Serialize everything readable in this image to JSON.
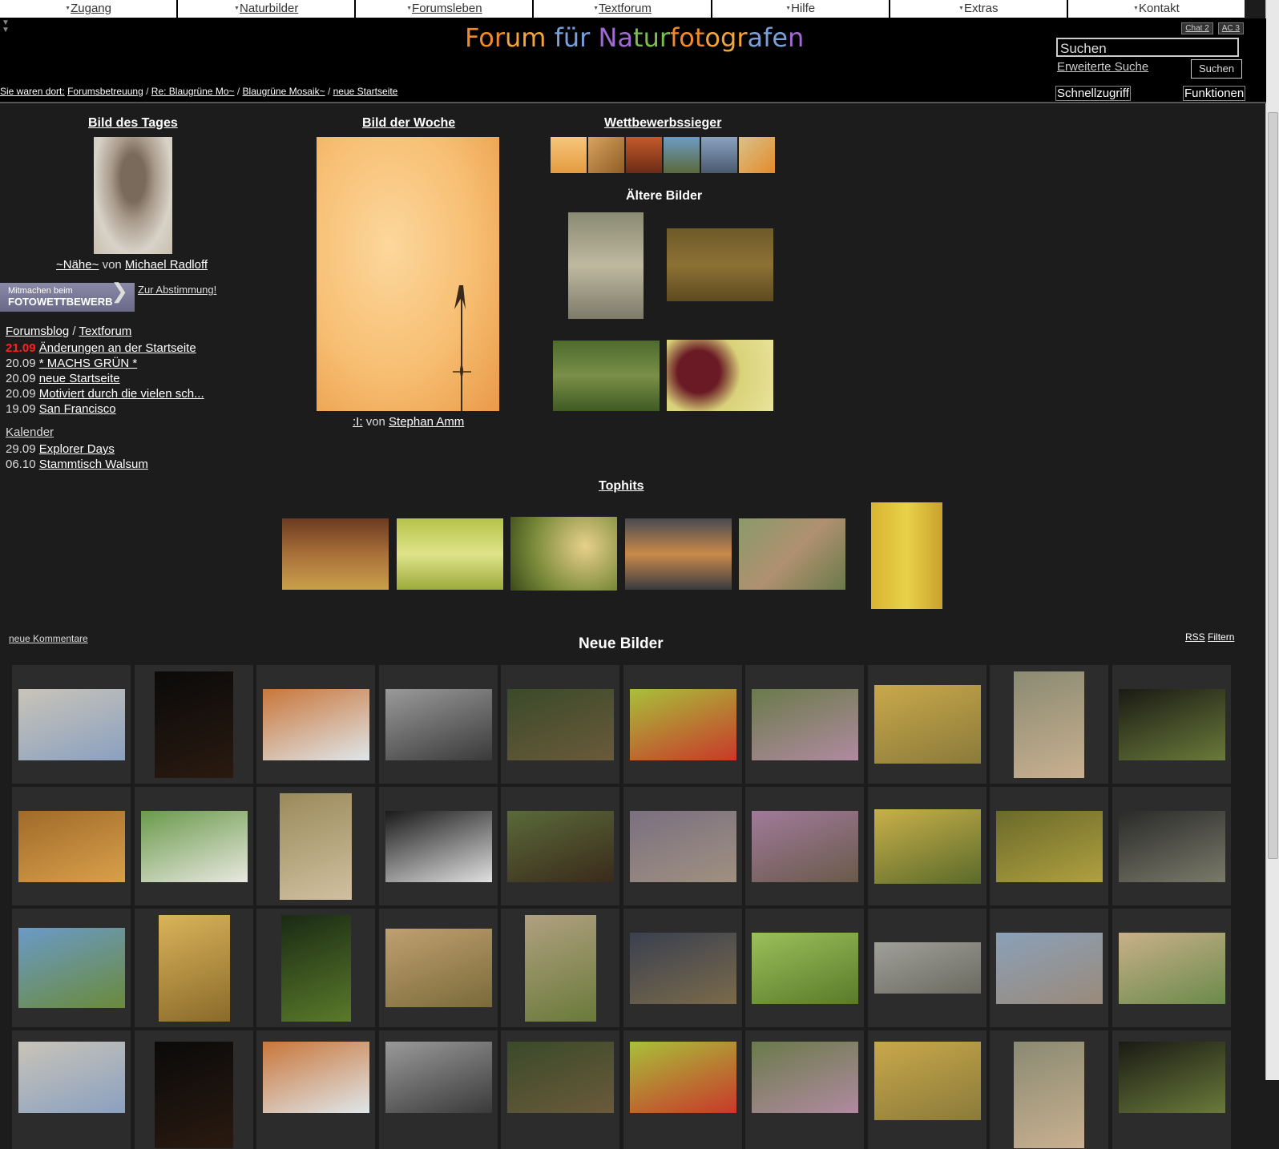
{
  "menu": [
    {
      "label": "Zugang"
    },
    {
      "label": "Naturbilder"
    },
    {
      "label": "Forumsleben"
    },
    {
      "label": "Textforum"
    },
    {
      "label": "Hilfe"
    },
    {
      "label": "Extras"
    },
    {
      "label": "Kontakt"
    }
  ],
  "logo": "Forum für Naturfotografen",
  "chat": {
    "chat2": "Chat 2",
    "ac3": "AC 3"
  },
  "search": {
    "value": "Suchen",
    "advanced": "Erweiterte Suche",
    "button": "Suchen"
  },
  "breadcrumb": {
    "prefix": "Sie waren dort:",
    "items": [
      "Forumsbetreuung",
      "Re: Blaugrüne Mo~",
      "Blaugrüne Mosaik~",
      "neue Startseite"
    ]
  },
  "quick": "Schnellzugriff",
  "functions": "Funktionen",
  "bild_des_tages": {
    "heading": "Bild des Tages",
    "title": "~Nähe~",
    "von": "von",
    "author": "Michael Radloff"
  },
  "voting": {
    "line1": "Mitmachen beim",
    "line2": "FOTOWETTBEWERB",
    "link": "Zur Abstimmung!"
  },
  "bild_der_woche": {
    "heading": "Bild der Woche",
    "title": ":I:",
    "von": "von",
    "author": "Stephan Amm"
  },
  "wettbewerb": {
    "heading": "Wettbewerbssieger"
  },
  "aeltere": {
    "heading": "Ältere Bilder"
  },
  "blog": {
    "forumsblog": "Forumsblog",
    "slash": "/",
    "textforum": "Textforum",
    "entries": [
      {
        "date": "21.09",
        "text": "Änderungen an der Startseite",
        "highlight": true
      },
      {
        "date": "20.09",
        "text": "* MACHS GRÜN *"
      },
      {
        "date": "20.09",
        "text": "neue Startseite"
      },
      {
        "date": "20.09",
        "text": "Motiviert durch die vielen sch..."
      },
      {
        "date": "19.09",
        "text": "San Francisco"
      }
    ],
    "kalender": "Kalender",
    "events": [
      {
        "date": "29.09",
        "text": "Explorer Days"
      },
      {
        "date": "06.10",
        "text": "Stammtisch Walsum"
      }
    ]
  },
  "tophits": {
    "heading": "Tophits"
  },
  "neue_bilder": {
    "heading": "Neue Bilder",
    "kommentare": "neue Kommentare",
    "rss": "RSS",
    "filtern": "Filtern"
  },
  "colors": {
    "accent_red": "#ff2020",
    "background": "#1c1c1c",
    "header": "#000000"
  }
}
